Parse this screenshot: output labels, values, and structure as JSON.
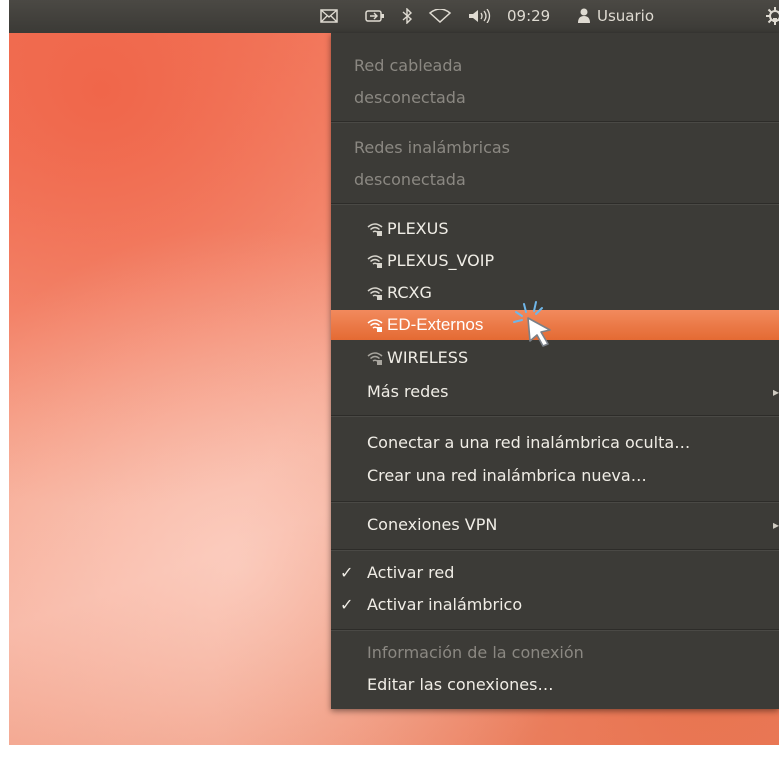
{
  "panel": {
    "time": "09:29",
    "user": "Usuario",
    "icons": [
      "mail-icon",
      "battery-icon",
      "bluetooth-icon",
      "network-icon",
      "volume-icon",
      "user-icon",
      "gear-icon"
    ]
  },
  "menu": {
    "wired_title": "Red cableada",
    "wired_status": "desconectada",
    "wireless_title": "Redes inalámbricas",
    "wireless_status": "desconectada",
    "networks": [
      "PLEXUS",
      "PLEXUS_VOIP",
      "RCXG",
      "ED-Externos",
      "WIRELESS"
    ],
    "highlighted_network": "ED-Externos",
    "more_networks": "Más redes",
    "connect_hidden": "Conectar a una red inalámbrica oculta…",
    "create_new": "Crear una red inalámbrica nueva…",
    "vpn": "Conexiones VPN",
    "enable_network": "Activar red",
    "enable_wireless": "Activar inalámbrico",
    "connection_info": "Información de la conexión",
    "edit_connections": "Editar las conexiones…",
    "check_mark": "✓",
    "submenu_arrow": "▸"
  },
  "colors": {
    "panel": "#3b3a36",
    "menu": "#3c3b37",
    "highlight": "#e46a33"
  }
}
